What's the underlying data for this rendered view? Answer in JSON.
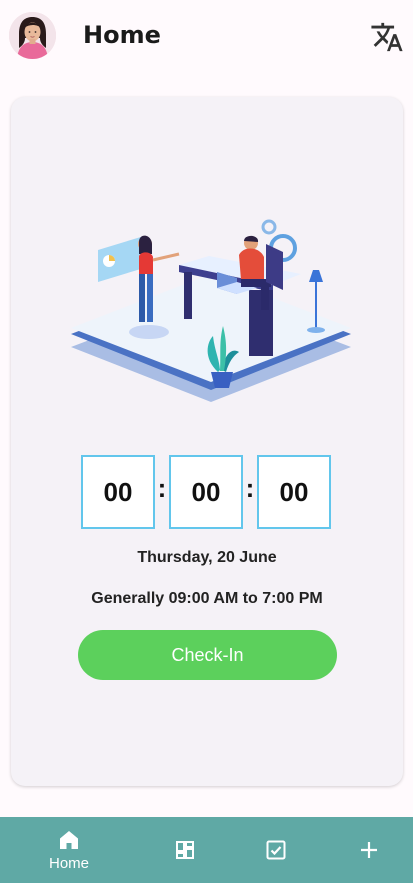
{
  "header": {
    "title": "Home",
    "avatar_icon": "user-avatar-photo",
    "translate_icon": "translate-icon"
  },
  "timer": {
    "hours": "00",
    "minutes": "00",
    "seconds": "00",
    "separator": ":"
  },
  "date_text": "Thursday, 20 June",
  "working_hours": "Generally 09:00 AM to 7:00 PM",
  "checkin_button": {
    "label": "Check-In",
    "color": "#5cd05c"
  },
  "bottom_nav": {
    "background": "#5fa9a5",
    "items": [
      {
        "label": "Home",
        "icon": "home-icon"
      },
      {
        "label": "",
        "icon": "dashboard-icon"
      },
      {
        "label": "",
        "icon": "checkbox-icon"
      },
      {
        "label": "",
        "icon": "plus-icon"
      }
    ]
  }
}
